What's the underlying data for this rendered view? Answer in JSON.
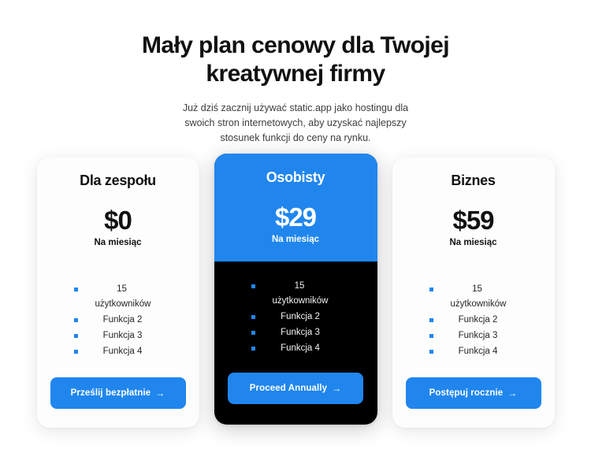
{
  "header": {
    "title": "Mały plan cenowy dla Twojej kreatywnej firmy",
    "subtitle": "Już dziś zacznij używać static.app jako hostingu dla swoich stron internetowych, aby uzyskać najlepszy stosunek funkcji do ceny na rynku."
  },
  "theme": {
    "accent": "#2086EE",
    "dark": "#000000",
    "card_bg": "#fdfdfd",
    "page_bg": "#ffffff",
    "text": "#111111"
  },
  "plans": [
    {
      "name": "Dla zespołu",
      "price": "$0",
      "period": "Na miesiąc",
      "features": [
        "15 użytkowników",
        "Funkcja 2",
        "Funkcja 3",
        "Funkcja 4"
      ],
      "cta_label": "Prześlij bezpłatnie",
      "cta_arrow": "→",
      "featured": false
    },
    {
      "name": "Osobisty",
      "price": "$29",
      "period": "Na miesiąc",
      "features": [
        "15 użytkowników",
        "Funkcja 2",
        "Funkcja 3",
        "Funkcja 4"
      ],
      "cta_label": "Proceed Annually",
      "cta_arrow": "→",
      "featured": true
    },
    {
      "name": "Biznes",
      "price": "$59",
      "period": "Na miesiąc",
      "features": [
        "15 użytkowników",
        "Funkcja 2",
        "Funkcja 3",
        "Funkcja 4"
      ],
      "cta_label": "Postępuj rocznie",
      "cta_arrow": "→",
      "featured": false
    }
  ]
}
